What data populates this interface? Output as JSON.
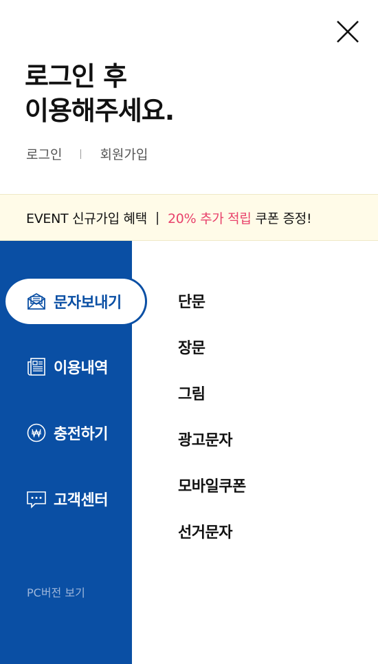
{
  "header": {
    "headline_line1": "로그인 후",
    "headline_line2": "이용해주세요.",
    "login_label": "로그인",
    "signup_label": "회원가입"
  },
  "event": {
    "prefix": "EVENT 신규가입 혜택",
    "separator": "|",
    "highlight": "20% 추가 적립",
    "suffix": "쿠폰 증정!"
  },
  "sidebar": {
    "items": [
      {
        "label": "문자보내기",
        "icon": "envelope-icon",
        "active": true
      },
      {
        "label": "이용내역",
        "icon": "document-icon",
        "active": false
      },
      {
        "label": "충전하기",
        "icon": "won-coin-icon",
        "active": false
      },
      {
        "label": "고객센터",
        "icon": "chat-bubble-icon",
        "active": false
      }
    ],
    "pc_link": "PC버전 보기"
  },
  "submenu": {
    "items": [
      "단문",
      "장문",
      "그림",
      "광고문자",
      "모바일쿠폰",
      "선거문자"
    ]
  },
  "colors": {
    "primary": "#0a4fa4",
    "event_bg": "#fffbe8",
    "highlight": "#e8426b"
  }
}
